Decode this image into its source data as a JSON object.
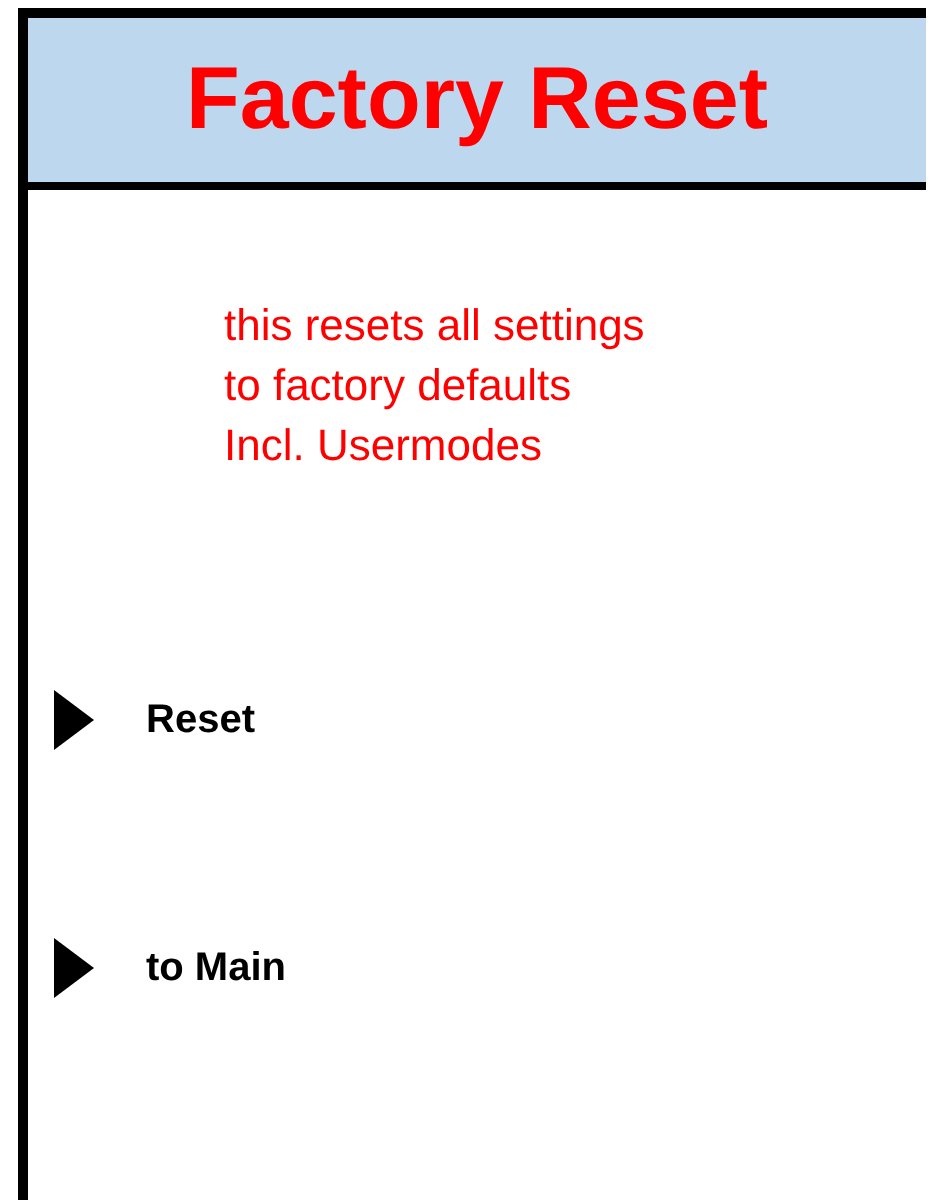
{
  "header": {
    "title": "Factory Reset"
  },
  "description": [
    "this resets all settings",
    "to factory defaults",
    "Incl. Usermodes"
  ],
  "menu_items": [
    {
      "label": "Reset"
    },
    {
      "label": "to Main"
    }
  ]
}
